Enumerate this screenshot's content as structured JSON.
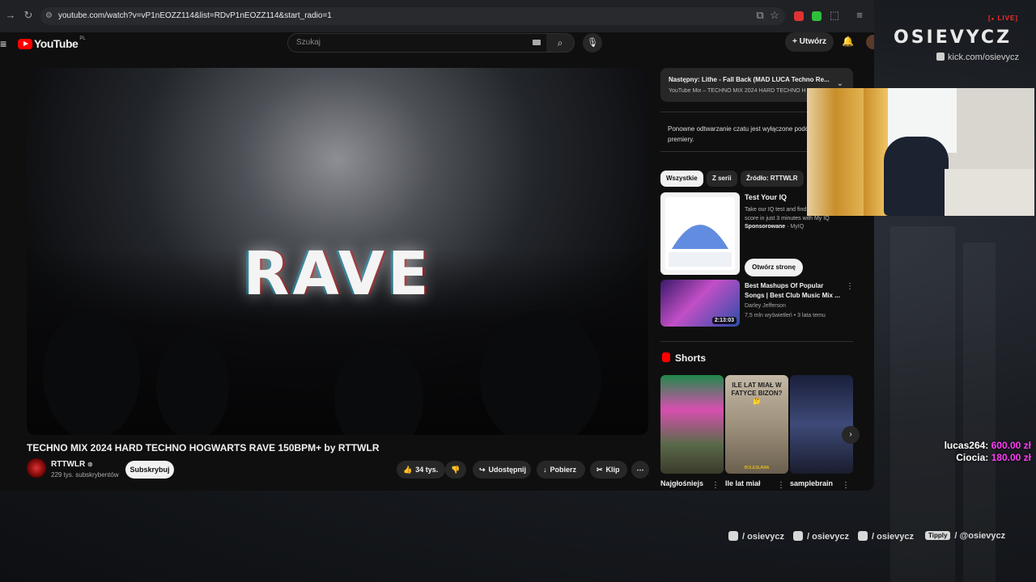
{
  "browser": {
    "url": "youtube.com/watch?v=vP1nEOZZ114&list=RDvP1nEOZZ114&start_radio=1"
  },
  "youtube": {
    "logo_text": "YouTube",
    "logo_region": "PL",
    "search_placeholder": "Szukaj",
    "create_label": "Utwórz"
  },
  "video": {
    "overlay_text": "RAVE",
    "title": "TECHNO MIX 2024 HARD TECHNO HOGWARTS RAVE 150BPM+ by RTTWLR",
    "channel_name": "RTTWLR",
    "subscribers": "229 tys. subskrybentów",
    "subscribe_label": "Subskrybuj",
    "actions": {
      "likes": "34 tys.",
      "share": "Udostępnij",
      "download": "Pobierz",
      "clip": "Klip"
    }
  },
  "sidebar": {
    "next_up": "Następny: Lithe - Fall Back (MAD LUCA Techno Re...",
    "next_sub": "YouTube Mix – TECHNO MIX 2024 HARD TECHNO HOGWARTS",
    "chat_disabled": "Ponowne odtwarzanie czatu jest wyłączone podczas tej premiery.",
    "chips": [
      "Wszystkie",
      "Z serii",
      "Źródło: RTTWLR"
    ],
    "ad": {
      "title": "Test Your IQ",
      "description": "Take our IQ test and find out your IQ score in just 3 minutes with My IQ",
      "sponsored": "Sponsorowane",
      "advertiser": "MyIQ",
      "cta": "Otwórz stronę"
    },
    "mix": {
      "title": "Best Mashups Of Popular Songs | Best Club Music Mix ...",
      "author": "Darley Jefferson",
      "views": "7,5 mln wyświetleń",
      "age": "3 lata temu",
      "duration": "2:13:03"
    },
    "shorts_title": "Shorts",
    "shorts": [
      {
        "label": "Najgłośniejs"
      },
      {
        "label": "Ile lat miał",
        "overlay": "ILE LAT MIAŁ W FATYCE BIZON? 🤔",
        "caption": "BOLESŁAWA"
      },
      {
        "label": "samplebrain"
      }
    ]
  },
  "overlay": {
    "live_badge": "LIVE",
    "brand": "OSIEVYCZ",
    "kick": "kick.com/osievycz",
    "donations": [
      {
        "user": "lucas264:",
        "amount": "600.00 zł"
      },
      {
        "user": "Ciocia:",
        "amount": "180.00 zł"
      }
    ],
    "socials": [
      {
        "icon": "instagram-icon",
        "text": "/ osievycz"
      },
      {
        "icon": "tiktok-icon",
        "text": "/ osievycz"
      },
      {
        "icon": "youtube-icon",
        "text": "/ osievycz"
      },
      {
        "icon": "tipply-icon",
        "badge": "Tipply",
        "text": "/ @osievycz"
      }
    ]
  }
}
